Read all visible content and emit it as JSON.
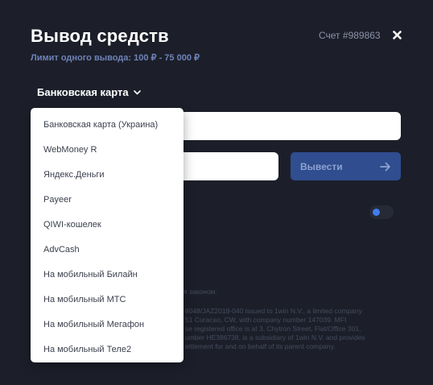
{
  "header": {
    "title": "Вывод средств",
    "limit": "Лимит одного вывода: 100 ₽ - 75 000 ₽",
    "account": "Счет #989863"
  },
  "method": {
    "selected": "Банковская карта",
    "options": [
      "Банковская карта (Украина)",
      "WebMoney R",
      "Яндекс.Деньги",
      "Payeer",
      "QIWI-кошелек",
      "AdvCash",
      "На мобильный Билайн",
      "На мобильный МТС",
      "На мобильный Мегафон",
      "На мобильный Теле2"
    ]
  },
  "form": {
    "submit_label": "Вывести"
  },
  "toggle": {
    "on": true
  },
  "legal": {
    "line1": "я законом.",
    "line2": "8048/JAZ2018-040 issued to 1win N.V., a limited company",
    "line3": "51 Curacao, CW, with company number 147039. MFI",
    "line4": "se registered office is at 3, Chytron Street, Flat/Office 301,",
    "line5": "umber HE386738, is a subsidiary of 1win N.V. and provides",
    "line6": "ettlement for and on behalf of its parent company."
  },
  "colors": {
    "background": "#1c1f2a",
    "accent": "#2f4d8f",
    "limit_text": "#6f83b8",
    "toggle_knob": "#3f7df0"
  },
  "icons": {
    "close": "close-icon",
    "chevron": "chevron-down-icon",
    "arrow": "arrow-right-icon"
  }
}
